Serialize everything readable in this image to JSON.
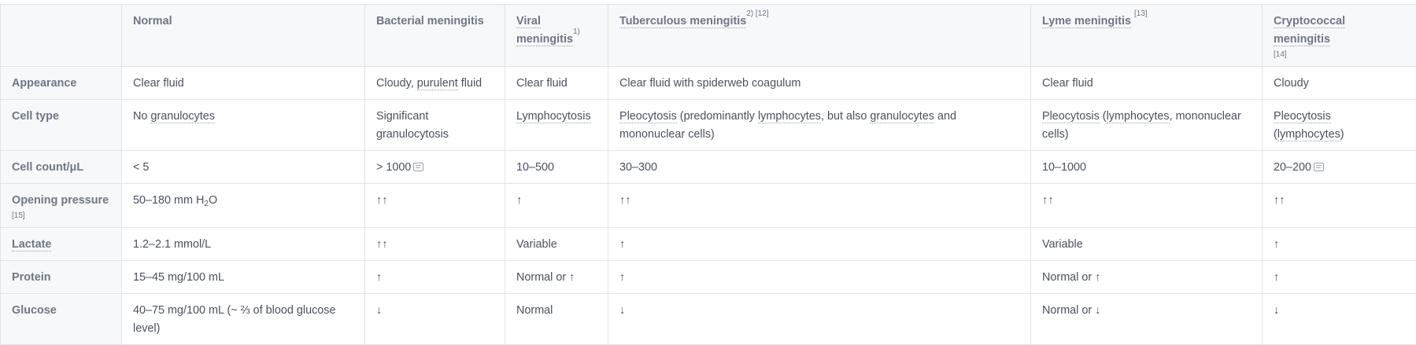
{
  "header": {
    "corner": "",
    "normal": "Normal",
    "bacterial": "Bacterial meningitis",
    "viral": "Viral meningitis",
    "viral_ref": "1)",
    "tuberculous": "Tuberculous meningitis",
    "tuberculous_ref": "2) [12]",
    "lyme": "Lyme meningitis",
    "lyme_ref": "[13]",
    "crypto": "Cryptococcal meningitis",
    "crypto_ref": "[14]"
  },
  "rows": {
    "appearance": {
      "label": "Appearance",
      "normal": "Clear fluid",
      "bacterial_a": "Cloudy, ",
      "bacterial_b": "purulent",
      "bacterial_c": " fluid",
      "viral": "Clear fluid",
      "tuberculous": "Clear fluid with spiderweb coagulum",
      "lyme": "Clear fluid",
      "crypto": "Cloudy"
    },
    "cell_type": {
      "label": "Cell type",
      "normal_a": "No ",
      "normal_b": "granulocytes",
      "bacterial": "Significant granulocytosis",
      "viral": "Lymphocytosis",
      "tb_a": "Pleocytosis",
      "tb_b": " (predominantly ",
      "tb_c": "lymphocytes",
      "tb_d": ", but also ",
      "tb_e": "granulocytes",
      "tb_f": " and mononuclear cells)",
      "lyme_a": "Pleocytosis",
      "lyme_b": " (",
      "lyme_c": "lymphocytes",
      "lyme_d": ", mononuclear cells)",
      "crypto_a": "Pleocytosis",
      "crypto_b": "(",
      "crypto_c": "lymphocytes",
      "crypto_d": ")"
    },
    "cell_count": {
      "label": "Cell count/μL",
      "normal": "< 5",
      "bacterial": "> 1000",
      "viral": "10–500",
      "tuberculous": "30–300",
      "lyme": "10–1000",
      "crypto": "20–200"
    },
    "opening_pressure": {
      "label": "Opening pressure",
      "label_ref": "[15]",
      "normal_a": "50–180 mm H",
      "normal_sub": "2",
      "normal_b": "O",
      "bacterial": "↑↑",
      "viral": "↑",
      "tuberculous": "↑↑",
      "lyme": "↑↑",
      "crypto": "↑↑"
    },
    "lactate": {
      "label": "Lactate",
      "normal": "1.2–2.1 mmol/L",
      "bacterial": "↑↑",
      "viral": "Variable",
      "tuberculous": "↑",
      "lyme": "Variable",
      "crypto": "↑"
    },
    "protein": {
      "label": "Protein",
      "normal": "15–45 mg/100 mL",
      "bacterial": "↑",
      "viral": "Normal or ↑",
      "tuberculous": "↑",
      "lyme": "Normal or ↑",
      "crypto": "↑"
    },
    "glucose": {
      "label": "Glucose",
      "normal": "40–75 mg/100 mL (~ ⅔ of blood glucose level)",
      "bacterial": "↓",
      "viral": "Normal",
      "tuberculous": "↓",
      "lyme": "Normal or ↓",
      "crypto": "↓"
    }
  },
  "icons": {
    "note": "note-icon"
  },
  "colors": {
    "border": "#dfe3e8",
    "header_bg": "#f6f8fa",
    "text": "#4a5160",
    "header_text": "#6f7685"
  }
}
